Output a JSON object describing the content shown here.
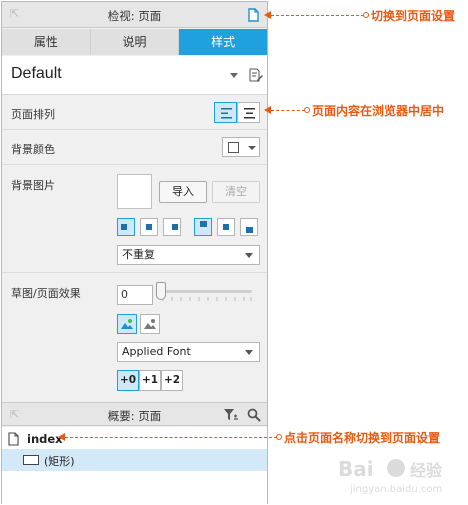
{
  "inspector": {
    "title": "检视: 页面",
    "tabs": [
      {
        "label": "属性",
        "active": false
      },
      {
        "label": "说明",
        "active": false
      },
      {
        "label": "样式",
        "active": true
      }
    ],
    "style_name": "Default",
    "page_alignment": {
      "label": "页面排列",
      "selected": "left"
    },
    "background_color": {
      "label": "背景颜色",
      "value": "#ffffff"
    },
    "background_image": {
      "label": "背景图片",
      "import_label": "导入",
      "clear_label": "清空",
      "repeat_value": "不重复",
      "horizontal_selected": "left",
      "vertical_selected": "top"
    },
    "sketch": {
      "label": "草图/页面效果",
      "sketchiness_value": "0",
      "font_value": "Applied Font",
      "color_mode": "color",
      "line_width": [
        {
          "label": "+0",
          "active": true
        },
        {
          "label": "+1",
          "active": false
        },
        {
          "label": "+2",
          "active": false
        }
      ]
    }
  },
  "outline": {
    "title": "概要: 页面",
    "items": [
      {
        "label": "index"
      },
      {
        "label": "(矩形)"
      }
    ]
  },
  "callouts": {
    "switch_to_page": "切换到页面设置",
    "center_page": "页面内容在浏览器中居中",
    "click_page_name": "点击页面名称切换到页面设置"
  },
  "colors": {
    "accent": "#1fa1e0",
    "callout": "#e85a10",
    "selected_bg": "#d3e9f8"
  }
}
